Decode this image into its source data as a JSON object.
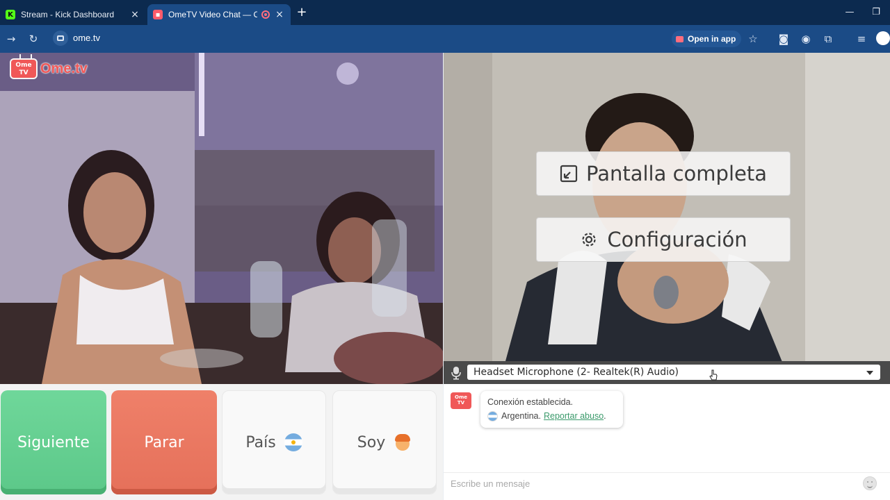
{
  "browser": {
    "tabs": [
      {
        "label": "Stream - Kick Dashboard",
        "favicon": "kick-icon",
        "close": "×"
      },
      {
        "label": "OmeTV Video Chat — Ome",
        "favicon": "ometv-icon",
        "close": "×"
      }
    ],
    "new_tab": "+",
    "window_controls": {
      "minimize": "—",
      "restore": "❐"
    },
    "url": "ome.tv",
    "open_in_app": "Open in app",
    "colors": {
      "tabbar": "#0c2a4f",
      "toolbar": "#1b4b86"
    }
  },
  "video": {
    "logo_small": "Ome TV",
    "logo_text": "Ome.tv",
    "fullscreen_label": "Pantalla completa",
    "settings_label": "Configuración",
    "microphone_select_value": "Headset Microphone (2- Realtek(R) Audio)"
  },
  "controls": {
    "next_label": "Siguiente",
    "stop_label": "Parar",
    "country_label": "País",
    "gender_label": "Soy",
    "colors": {
      "next": "#5cc889",
      "stop": "#e5705a"
    }
  },
  "chat": {
    "logo": "Ome TV",
    "connection_message": "Conexión establecida.",
    "country": "Argentina.",
    "report_link": "Reportar abuso",
    "report_suffix": ".",
    "input_placeholder": "Escribe un mensaje"
  }
}
